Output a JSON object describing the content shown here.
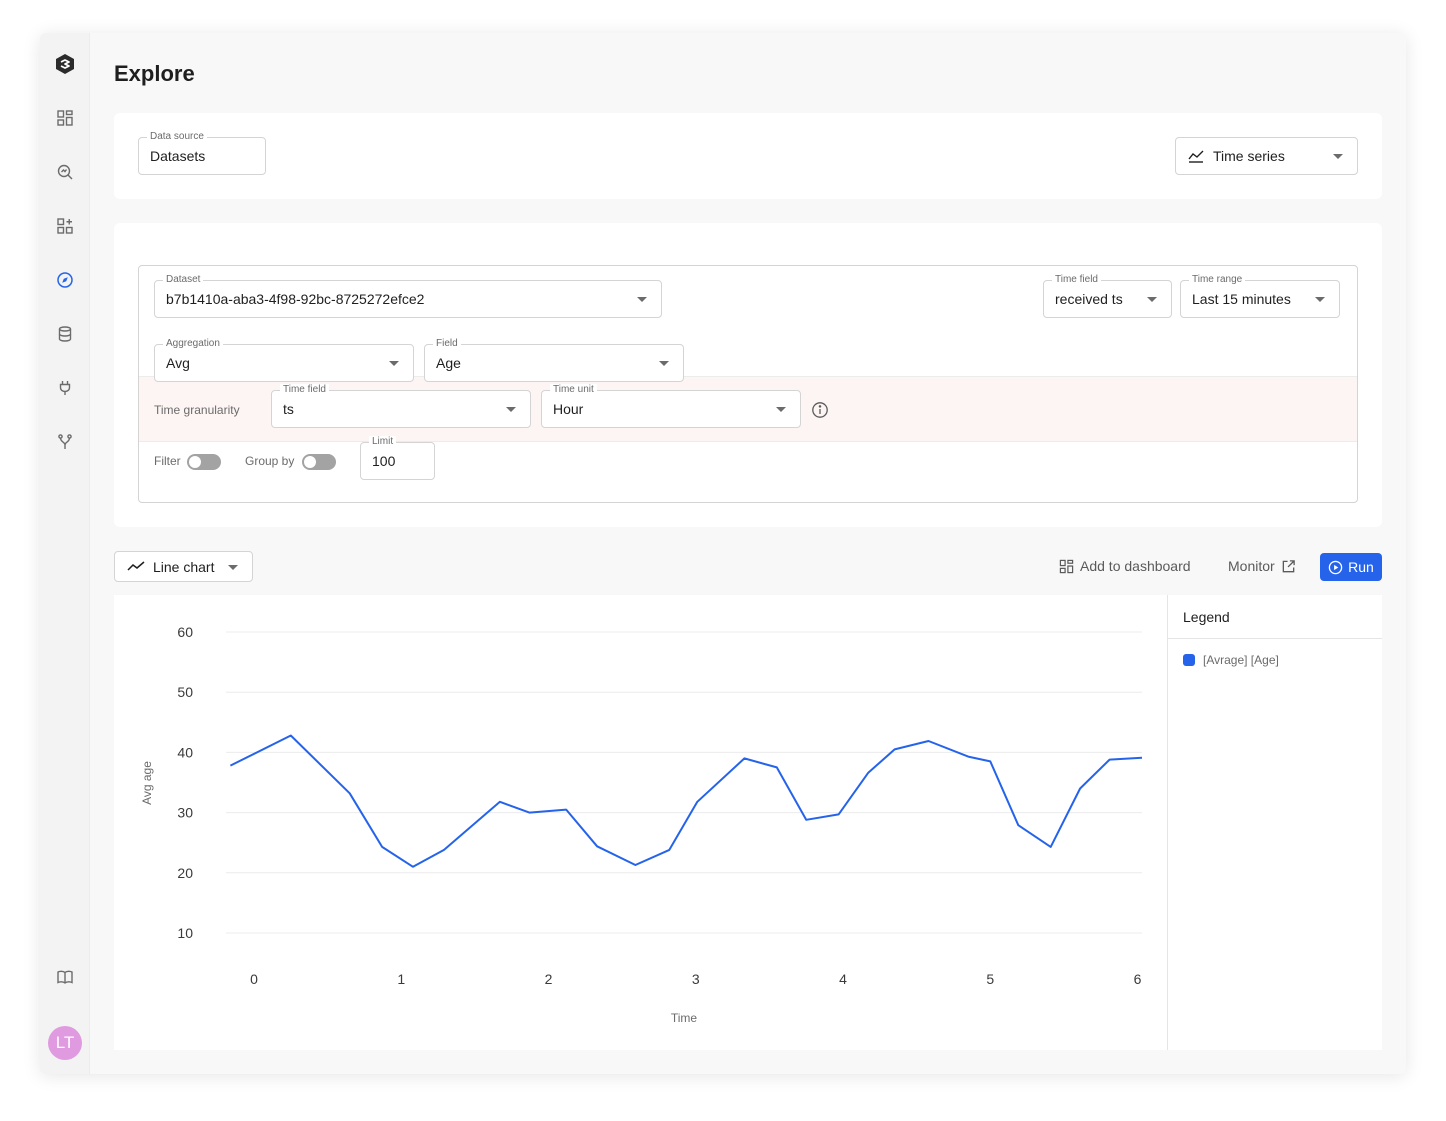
{
  "page": {
    "title": "Explore"
  },
  "sidebar": {
    "items": [
      {
        "icon": "logo-icon"
      },
      {
        "icon": "dashboard-icon"
      },
      {
        "icon": "search-analytics-icon"
      },
      {
        "icon": "add-widget-icon"
      },
      {
        "icon": "compass-icon",
        "active": true
      },
      {
        "icon": "database-icon"
      },
      {
        "icon": "plug-icon"
      },
      {
        "icon": "branch-icon"
      },
      {
        "icon": "book-icon"
      }
    ],
    "avatar_initials": "LT",
    "active_color": "#2563eb"
  },
  "source": {
    "data_source_label": "Data source",
    "data_source_value": "Datasets",
    "viz_type_value": "Time series"
  },
  "query": {
    "dataset_label": "Dataset",
    "dataset_value": "b7b1410a-aba3-4f98-92bc-8725272efce2",
    "time_field_label": "Time field",
    "time_field_value": "received ts",
    "time_range_label": "Time range",
    "time_range_value": "Last 15 minutes",
    "aggregation_label": "Aggregation",
    "aggregation_value": "Avg",
    "field_label": "Field",
    "field_value": "Age",
    "granularity_label": "Time granularity",
    "gran_time_field_label": "Time field",
    "gran_time_field_value": "ts",
    "time_unit_label": "Time unit",
    "time_unit_value": "Hour",
    "filter_label": "Filter",
    "group_by_label": "Group by",
    "limit_label": "Limit",
    "limit_value": "100"
  },
  "toolbar": {
    "chart_type": "Line chart",
    "add_to_dashboard": "Add to dashboard",
    "monitor": "Monitor",
    "run": "Run"
  },
  "legend": {
    "title": "Legend"
  },
  "chart_data": {
    "type": "line",
    "xlabel": "Time",
    "ylabel": "Avg age",
    "x_ticks": [
      0,
      1,
      2,
      3,
      4,
      5,
      6
    ],
    "y_ticks": [
      10,
      20,
      30,
      40,
      50,
      60
    ],
    "xlim": [
      -0.19,
      6.03
    ],
    "ylim": [
      10,
      60
    ],
    "grid": true,
    "legend_position": "right",
    "series": [
      {
        "name": "[Avrage] [Age]",
        "color": "#2563eb",
        "x": [
          -0.16,
          0.25,
          0.65,
          0.87,
          1.08,
          1.29,
          1.67,
          1.87,
          2.12,
          2.33,
          2.59,
          2.82,
          3.01,
          3.33,
          3.55,
          3.75,
          3.97,
          4.17,
          4.35,
          4.58,
          4.85,
          5.0,
          5.19,
          5.41,
          5.61,
          5.81,
          6.03
        ],
        "y": [
          37.8,
          42.8,
          33.2,
          24.3,
          21.0,
          23.8,
          31.8,
          30.0,
          30.5,
          24.4,
          21.3,
          23.8,
          31.8,
          39.0,
          37.5,
          28.8,
          29.7,
          36.6,
          40.5,
          41.9,
          39.3,
          38.5,
          27.9,
          24.3,
          34.0,
          38.8,
          39.1
        ]
      }
    ]
  }
}
